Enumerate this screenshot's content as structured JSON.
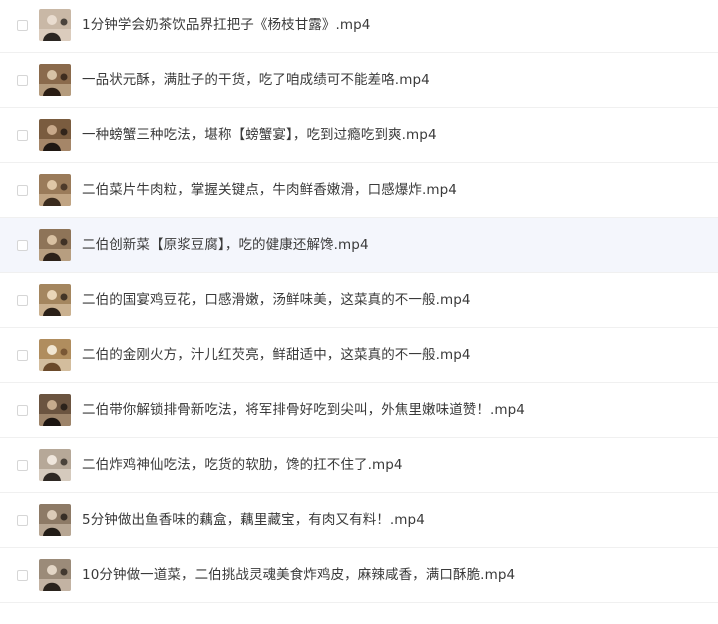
{
  "files": [
    {
      "name": "1分钟学会奶茶饮品界扛把子《杨枝甘露》.mp4",
      "icon": "video-thumbnail",
      "thumb": {
        "bg": "#c9b8a6",
        "a": "#2b2622",
        "b": "#e9dccf"
      }
    },
    {
      "name": "一品状元酥，满肚子的干货，吃了咱成绩可不能差咯.mp4",
      "icon": "video-thumbnail",
      "thumb": {
        "bg": "#8a6a4c",
        "a": "#2a1d14",
        "b": "#d7c2a5"
      }
    },
    {
      "name": "一种螃蟹三种吃法，堪称【螃蟹宴】，吃到过瘾吃到爽.mp4",
      "icon": "video-thumbnail",
      "thumb": {
        "bg": "#7a5c3f",
        "a": "#1f1712",
        "b": "#c8a98a"
      }
    },
    {
      "name": "二伯菜片牛肉粒，掌握关键点，牛肉鲜香嫩滑，口感爆炸.mp4",
      "icon": "video-thumbnail",
      "thumb": {
        "bg": "#9a7b5a",
        "a": "#3a2b1e",
        "b": "#e0c7a6"
      }
    },
    {
      "name": "二伯创新菜【原浆豆腐】，吃的健康还解馋.mp4",
      "icon": "video-thumbnail",
      "thumb": {
        "bg": "#8e7458",
        "a": "#2c2119",
        "b": "#d9c1a2"
      }
    },
    {
      "name": "二伯的国宴鸡豆花，口感滑嫩，汤鲜味美，这菜真的不一般.mp4",
      "icon": "video-thumbnail",
      "thumb": {
        "bg": "#a4865f",
        "a": "#2a2018",
        "b": "#ead6b8"
      }
    },
    {
      "name": "二伯的金刚火方，汁儿红芡亮，鲜甜适中，这菜真的不一般.mp4",
      "icon": "video-thumbnail",
      "thumb": {
        "bg": "#b08d5e",
        "a": "#6b4a2a",
        "b": "#f1e6d2"
      }
    },
    {
      "name": "二伯带你解锁排骨新吃法，将军排骨好吃到尖叫，外焦里嫩味道赞！.mp4",
      "icon": "video-thumbnail",
      "thumb": {
        "bg": "#6b5440",
        "a": "#1c1511",
        "b": "#c6ab8d"
      }
    },
    {
      "name": "二伯炸鸡神仙吃法，吃货的软肋，馋的扛不住了.mp4",
      "icon": "video-thumbnail",
      "thumb": {
        "bg": "#b6a898",
        "a": "#2e2823",
        "b": "#efe6dc"
      }
    },
    {
      "name": "5分钟做出鱼香味的藕盒，藕里藏宝，有肉又有料！.mp4",
      "icon": "video-thumbnail",
      "thumb": {
        "bg": "#8d7a66",
        "a": "#221c17",
        "b": "#dbcbb8"
      }
    },
    {
      "name": "10分钟做一道菜，二伯挑战灵魂美食炸鸡皮，麻辣咸香，满口酥脆.mp4",
      "icon": "video-thumbnail",
      "thumb": {
        "bg": "#9b8b79",
        "a": "#2a231d",
        "b": "#e3d6c6"
      }
    }
  ],
  "hover_row_index": 4
}
